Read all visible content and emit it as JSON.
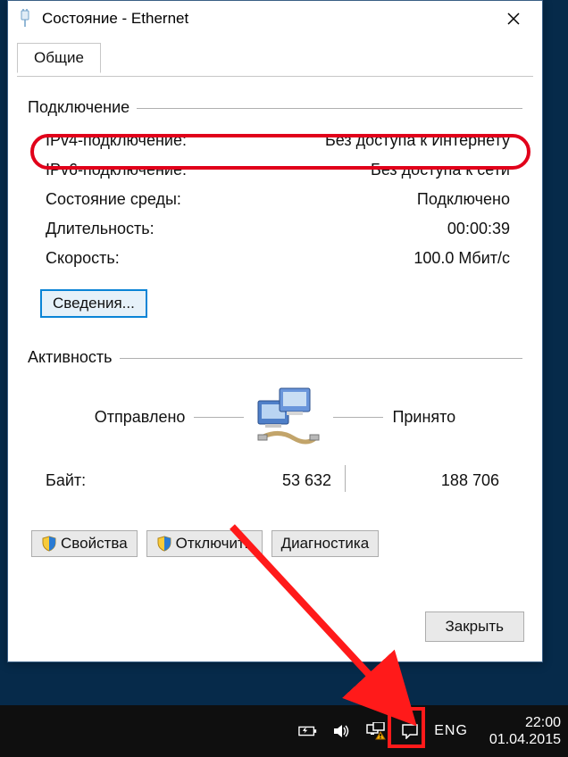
{
  "window": {
    "title": "Состояние - Ethernet",
    "tab_general": "Общие"
  },
  "connection_group": {
    "title": "Подключение",
    "rows": {
      "ipv4_label": "IPv4-подключение:",
      "ipv4_value": "Без доступа к Интернету",
      "ipv6_label": "IPv6-подключение:",
      "ipv6_value": "Без доступа к сети",
      "media_label": "Состояние среды:",
      "media_value": "Подключено",
      "duration_label": "Длительность:",
      "duration_value": "00:00:39",
      "speed_label": "Скорость:",
      "speed_value": "100.0 Мбит/с"
    },
    "details_button": "Сведения..."
  },
  "activity_group": {
    "title": "Активность",
    "sent_label": "Отправлено",
    "received_label": "Принято",
    "bytes_label": "Байт:",
    "sent_value": "53 632",
    "received_value": "188 706"
  },
  "buttons": {
    "properties": "Свойства",
    "disable": "Отключить",
    "diagnose": "Диагностика",
    "close": "Закрыть"
  },
  "taskbar": {
    "language": "ENG",
    "time": "22:00",
    "date": "01.04.2015"
  }
}
